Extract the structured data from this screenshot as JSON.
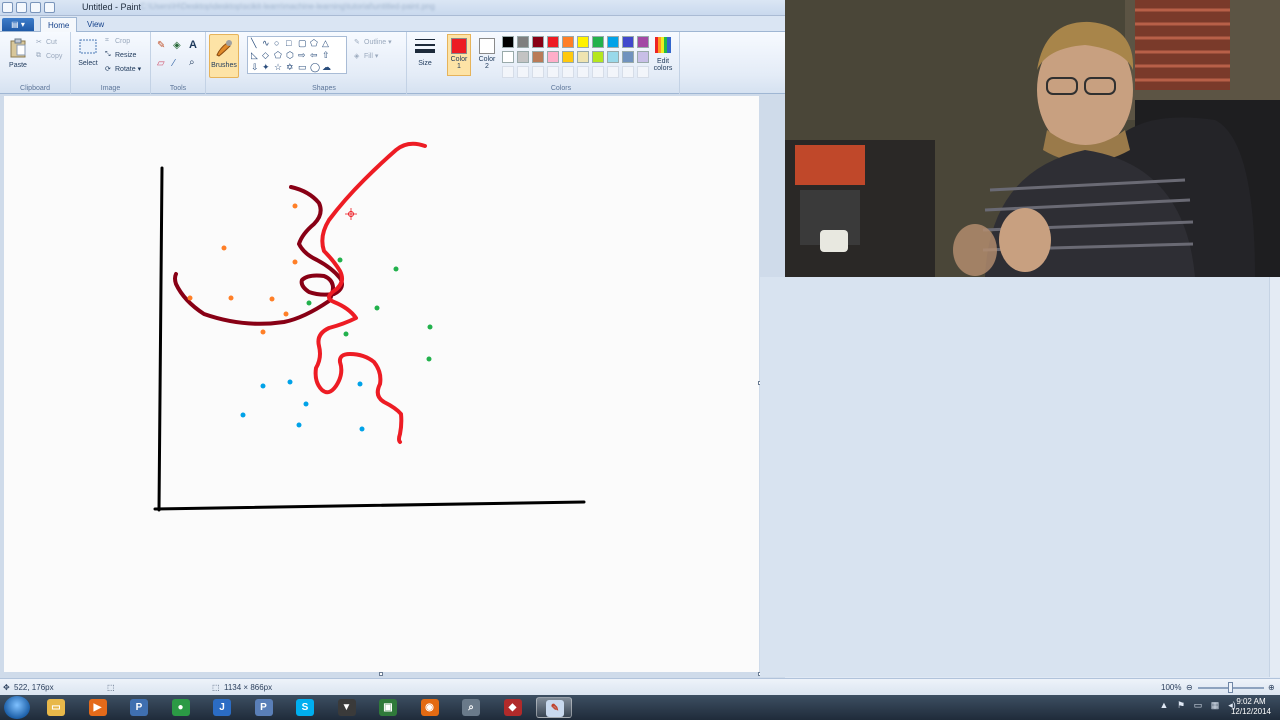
{
  "window": {
    "title": "Untitled - Paint",
    "title_path": "C:\\Users\\H\\Desktop\\desktop\\scikit-learn\\machine-learning\\tutorial\\untitled-paint.png"
  },
  "tabs": [
    {
      "label": "Home",
      "active": true
    },
    {
      "label": "View",
      "active": false
    }
  ],
  "ribbon": {
    "clipboard": {
      "label": "Clipboard",
      "paste": "Paste",
      "cut": "Cut",
      "copy": "Copy"
    },
    "image": {
      "label": "Image",
      "select": "Select",
      "crop": "Crop",
      "resize": "Resize",
      "rotate": "Rotate"
    },
    "tools": {
      "label": "Tools"
    },
    "brushes": {
      "label": "Brushes"
    },
    "shapes": {
      "label": "Shapes",
      "outline": "Outline",
      "fill": "Fill"
    },
    "size": {
      "label": "Size"
    },
    "colors": {
      "label": "Colors",
      "color1": {
        "label": "Color",
        "num": "1",
        "value": "#ed1c24"
      },
      "color2": {
        "label": "Color",
        "num": "2",
        "value": "#ffffff"
      },
      "edit": "Edit colors",
      "palette_row1": [
        "#000000",
        "#7f7f7f",
        "#880015",
        "#ed1c24",
        "#ff7f27",
        "#fff200",
        "#22b14c",
        "#00a2e8",
        "#3f48cc",
        "#a349a4"
      ],
      "palette_row2": [
        "#ffffff",
        "#c3c3c3",
        "#b97a57",
        "#ffaec9",
        "#ffc90e",
        "#efe4b0",
        "#b5e61d",
        "#99d9ea",
        "#7092be",
        "#c8bfe7"
      ]
    }
  },
  "drawing": {
    "stroke_colors": {
      "axes": "#000000",
      "dark_boundary": "#880015",
      "red_boundary": "#ed1c24"
    },
    "point_colors": {
      "orange": "#ff7f27",
      "green": "#22b14c",
      "blue": "#00a2e8"
    }
  },
  "status": {
    "cursor_pos": "522, 176px",
    "canvas_size": "1134 × 866px",
    "zoom": "100%"
  },
  "taskbar": {
    "apps": [
      {
        "name": "explorer",
        "color": "#e8b84a",
        "glyph": "▭"
      },
      {
        "name": "media-player",
        "color": "#e46a1a",
        "glyph": "▶"
      },
      {
        "name": "python",
        "color": "#3f6fb0",
        "glyph": "P"
      },
      {
        "name": "chrome",
        "color": "#2b9a45",
        "glyph": "●"
      },
      {
        "name": "jetbrains",
        "color": "#2b6cc4",
        "glyph": "J"
      },
      {
        "name": "python-idle",
        "color": "#5a7fb8",
        "glyph": "P"
      },
      {
        "name": "skype",
        "color": "#00aff0",
        "glyph": "S"
      },
      {
        "name": "game",
        "color": "#3a3a3a",
        "glyph": "▼"
      },
      {
        "name": "terminal",
        "color": "#2f7a3a",
        "glyph": "▣"
      },
      {
        "name": "firefox",
        "color": "#e36a12",
        "glyph": "◉"
      },
      {
        "name": "search",
        "color": "#6a7a8a",
        "glyph": "⌕"
      },
      {
        "name": "media",
        "color": "#b12a2a",
        "glyph": "◆"
      },
      {
        "name": "paint",
        "color": "#c9d9ee",
        "glyph": "✎",
        "active": true
      }
    ],
    "time": "9:02 AM",
    "date": "12/12/2014"
  }
}
